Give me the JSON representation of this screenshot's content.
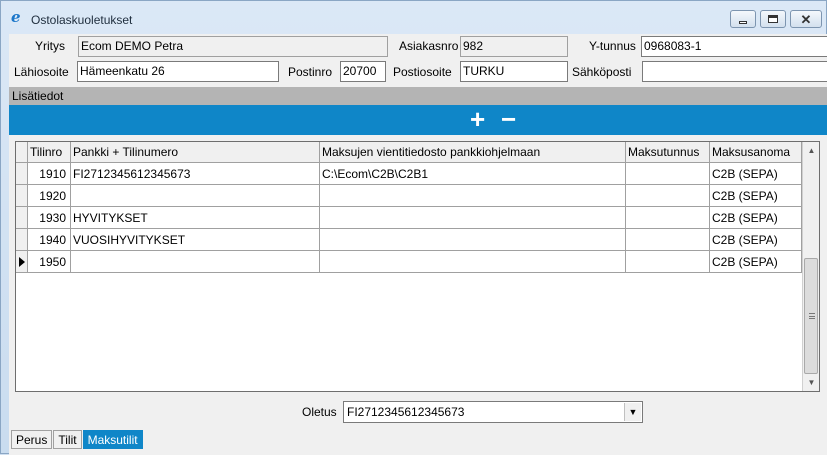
{
  "window": {
    "title": "Ostolaskuoletukset"
  },
  "form": {
    "yritys_label": "Yritys",
    "yritys_value": "Ecom DEMO Petra",
    "asiakasnro_label": "Asiakasnro",
    "asiakasnro_value": "982",
    "ytunnus_label": "Y-tunnus",
    "ytunnus_value": "0968083-1",
    "lahiosoite_label": "Lähiosoite",
    "lahiosoite_value": "Hämeenkatu 26",
    "postinro_label": "Postinro",
    "postinro_value": "20700",
    "postiosoite_label": "Postiosoite",
    "postiosoite_value": "TURKU",
    "sahkoposti_label": "Sähköposti",
    "sahkoposti_value": ""
  },
  "section": {
    "title": "Lisätiedot"
  },
  "toolbar": {
    "add_label": "+",
    "remove_label": "−"
  },
  "grid": {
    "columns": [
      "Tilinro",
      "Pankki + Tilinumero",
      "Maksujen vientitiedosto pankkiohjelmaan",
      "Maksutunnus",
      "Maksusanoma"
    ],
    "rows": [
      {
        "tilinro": "1910",
        "pankki": "FI2712345612345673",
        "vienti": "C:\\Ecom\\C2B\\C2B1",
        "maksutunnus": "",
        "sanoma": "C2B (SEPA)"
      },
      {
        "tilinro": "1920",
        "pankki": "",
        "vienti": "",
        "maksutunnus": "",
        "sanoma": "C2B (SEPA)"
      },
      {
        "tilinro": "1930",
        "pankki": "HYVITYKSET",
        "vienti": "",
        "maksutunnus": "",
        "sanoma": "C2B (SEPA)"
      },
      {
        "tilinro": "1940",
        "pankki": "VUOSIHYVITYKSET",
        "vienti": "",
        "maksutunnus": "",
        "sanoma": "C2B (SEPA)"
      },
      {
        "tilinro": "1950",
        "pankki": "",
        "vienti": "",
        "maksutunnus": "",
        "sanoma": "C2B (SEPA)"
      }
    ]
  },
  "oletus": {
    "label": "Oletus",
    "value": "FI2712345612345673"
  },
  "tabs": [
    {
      "label": "Perus"
    },
    {
      "label": "Tilit"
    },
    {
      "label": "Maksutilit"
    }
  ],
  "colors": {
    "accent": "#0f86c8",
    "section_header": "#b4b4b4"
  }
}
